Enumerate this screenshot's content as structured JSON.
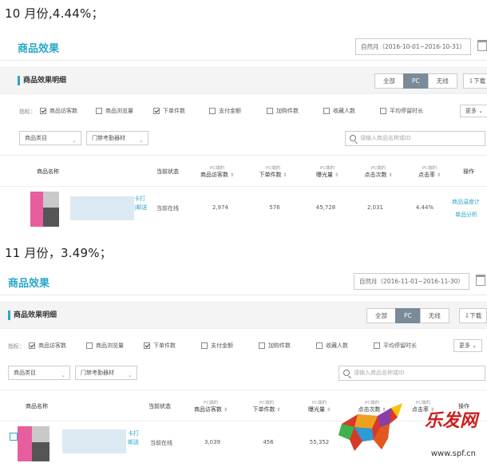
{
  "captions": {
    "oct": "10 月份,4.44%；",
    "nov": "11 月份，3.49%；"
  },
  "panel_common": {
    "section_title": "商品效果",
    "sub_title": "商品效果明细",
    "segments": [
      "全部",
      "PC",
      "无线"
    ],
    "active_segment": "PC",
    "metrics_label": "指标：",
    "checkboxes": [
      {
        "label": "商品访客数",
        "checked": true
      },
      {
        "label": "商品浏览量",
        "checked": false
      },
      {
        "label": "下单件数",
        "checked": true
      },
      {
        "label": "支付金额",
        "checked": false
      },
      {
        "label": "加购件数",
        "checked": false
      },
      {
        "label": "收藏人数",
        "checked": false
      },
      {
        "label": "平均停留时长",
        "checked": false
      }
    ],
    "more_label": "更多",
    "category_select": "商品类目",
    "brand_select": "门禁考勤器材",
    "search_placeholder": "请输入商品名称或ID",
    "columns": {
      "name": "商品名称",
      "status": "当前状态",
      "pc_tag": "PC端的",
      "visitors": "商品访客数",
      "orders": "下单件数",
      "exposure": "曝光量",
      "clicks": "点击次数",
      "ctr": "点击率",
      "action": "操作"
    }
  },
  "oct_panel": {
    "date_range": "自然月（2016-10-01~2016-10-31）",
    "download_label": "下载",
    "row": {
      "status": "当前在线",
      "visitors": "2,974",
      "orders": "576",
      "exposure": "45,728",
      "clicks": "2,031",
      "ctr": "4.44%",
      "action1": "商品温度计",
      "action2": "单品分析",
      "name_frag1": "卡打",
      "name_frag2": "|邮送"
    }
  },
  "nov_panel": {
    "date_range": "自然月（2016-11-01~2016-11-30）",
    "download_label": "下载",
    "row": {
      "status": "当前在线",
      "visitors": "3,039",
      "orders": "456",
      "exposure": "55,352",
      "name_frag1": "卡打",
      "name_frag2": "邮送"
    }
  },
  "watermark": {
    "text": "乐发网",
    "url": "www.spf.cn"
  },
  "colors": {
    "accent": "#2aa7c8",
    "active_segment_bg": "#7a8a99",
    "watermark_red": "#cc1f1f"
  }
}
